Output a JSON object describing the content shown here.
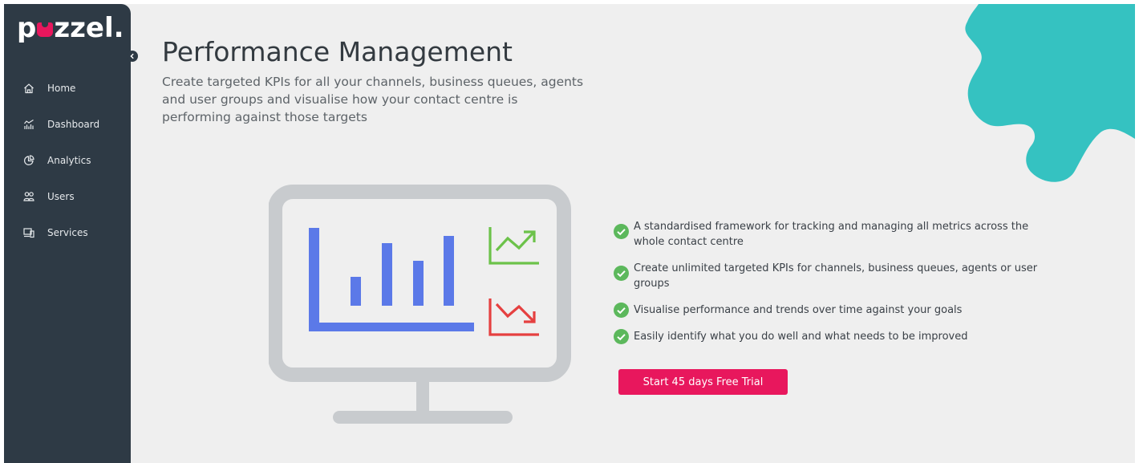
{
  "brand": {
    "logo_prefix": "p",
    "logo_suffix": "zzel.",
    "accent": "#e8175d",
    "sidebar_bg": "#2e3a45",
    "teal": "#35c2c1"
  },
  "sidebar": {
    "collapse_icon": "chevron-left-icon",
    "items": [
      {
        "label": "Home",
        "icon": "home-icon"
      },
      {
        "label": "Dashboard",
        "icon": "dashboard-icon"
      },
      {
        "label": "Analytics",
        "icon": "analytics-icon"
      },
      {
        "label": "Users",
        "icon": "users-icon"
      },
      {
        "label": "Services",
        "icon": "services-icon"
      }
    ]
  },
  "main": {
    "title": "Performance Management",
    "description_lines": [
      "Create targeted KPIs for all your channels, business queues, agents",
      "and user groups and visualise how your contact centre is",
      "performing against those targets"
    ],
    "features": [
      {
        "lines": [
          "A standardised framework for tracking and managing all metrics across the",
          "whole contact centre"
        ]
      },
      {
        "lines": [
          "Create unlimited targeted KPIs for channels, business queues, agents or user",
          "groups"
        ]
      },
      {
        "lines": [
          "Visualise performance and trends over time against your goals"
        ]
      },
      {
        "lines": [
          "Easily identify what you do well and what needs to be improved"
        ]
      }
    ],
    "cta_label": "Start 45 days Free Trial"
  }
}
